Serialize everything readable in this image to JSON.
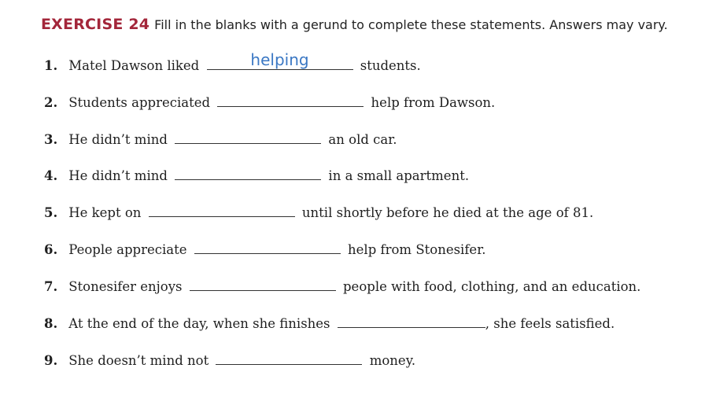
{
  "exercise": {
    "label": "EXERCISE 24",
    "instructions": "Fill in the blanks with a gerund to complete these statements. Answers may vary."
  },
  "items": [
    {
      "number": "1.",
      "before": "Matel Dawson liked",
      "answer": "helping",
      "after": "students."
    },
    {
      "number": "2.",
      "before": "Students appreciated",
      "answer": "",
      "after": "help from Dawson."
    },
    {
      "number": "3.",
      "before": "He didn’t mind",
      "answer": "",
      "after": "an old car."
    },
    {
      "number": "4.",
      "before": "He didn’t mind",
      "answer": "",
      "after": "in a small apartment."
    },
    {
      "number": "5.",
      "before": "He kept on",
      "answer": "",
      "after": "until shortly before he died at the age of 81."
    },
    {
      "number": "6.",
      "before": "People appreciate",
      "answer": "",
      "after": "help from Stonesifer."
    },
    {
      "number": "7.",
      "before": "Stonesifer enjoys",
      "answer": "",
      "after": "people with food, clothing, and an education."
    },
    {
      "number": "8.",
      "before": "At the end of the day, when she finishes",
      "answer": "",
      "after": ", she feels satisfied."
    },
    {
      "number": "9.",
      "before": "She doesn’t mind not",
      "answer": "",
      "after": "money."
    }
  ],
  "colors": {
    "heading_accent": "#a3263a",
    "handwritten_answer": "#3b78c4"
  }
}
